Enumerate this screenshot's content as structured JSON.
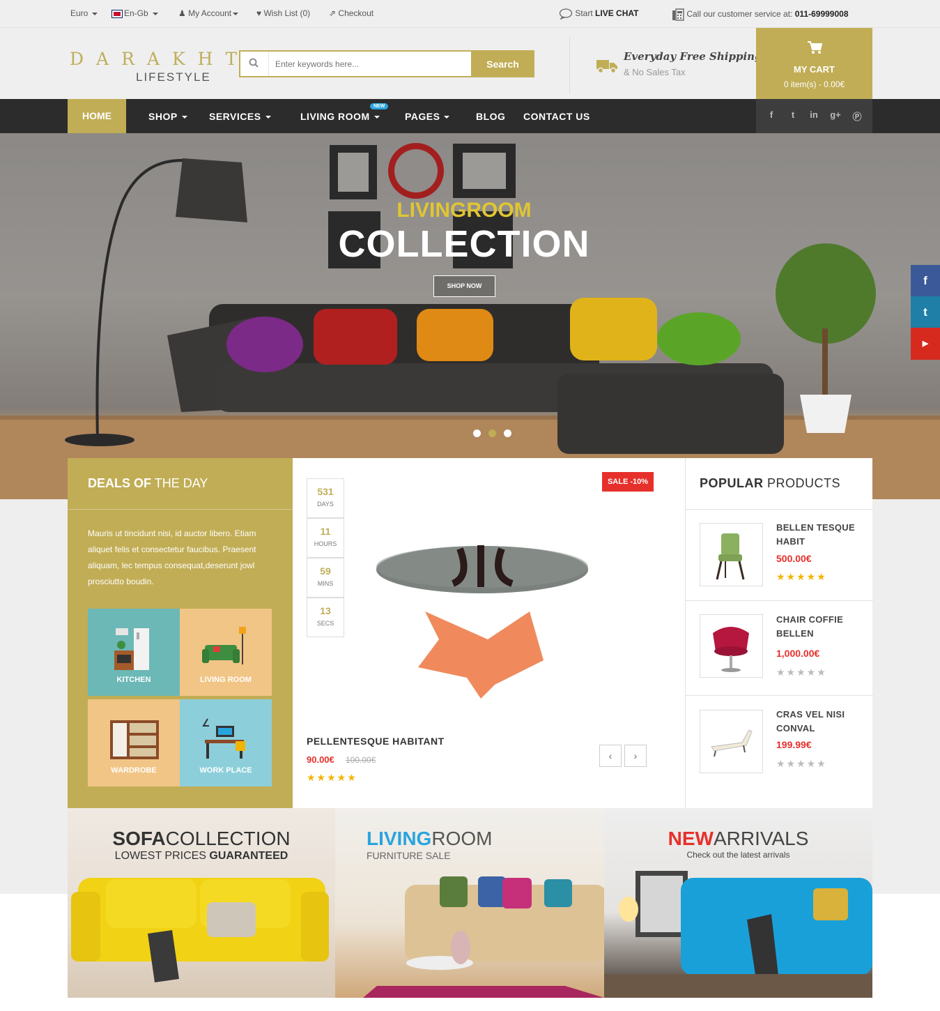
{
  "topbar": {
    "currency": "Euro",
    "language": "En-Gb",
    "account": "My Account",
    "wishlist": "Wish List (0)",
    "checkout": "Checkout",
    "chat_prefix": "Start",
    "chat_bold": "LIVE CHAT",
    "service_prefix": "Call our customer service at:",
    "service_phone": "011-69999008"
  },
  "header": {
    "logo_top": "DARAKHT",
    "logo_sub": "LIFESTYLE",
    "search_placeholder": "Enter keywords here...",
    "search_button": "Search",
    "shipping_title": "Everyday Free Shipping",
    "shipping_sub": "& No Sales Tax",
    "cart_title": "MY CART",
    "cart_summary": "0 item(s) - 0.00€"
  },
  "nav": {
    "items": [
      "HOME",
      "SHOP",
      "SERVICES",
      "LIVING ROOM",
      "PAGES",
      "BLOG",
      "CONTACT US"
    ],
    "new_badge": "NEW"
  },
  "hero": {
    "kicker": "LIVINGROOM",
    "title": "COLLECTION",
    "button": "SHOP NOW",
    "slides": 3,
    "active_slide": 2
  },
  "deals": {
    "title_bold": "DEALS OF",
    "title_light": "THE DAY",
    "description": "Mauris ut tincidunt nisi, id auctor libero. Etiam aliquet felis et consectetur faucibus. Praesent aliquam, lec tempus consequat,deserunt jowl prosciutto boudin.",
    "tiles": [
      {
        "label": "KITCHEN",
        "color": "#6cb8b7"
      },
      {
        "label": "LIVING ROOM",
        "color": "#f1c586"
      },
      {
        "label": "WARDROBE",
        "color": "#f1c586"
      },
      {
        "label": "WORK PLACE",
        "color": "#8ccfda"
      }
    ]
  },
  "deal_product": {
    "countdown": [
      {
        "value": "531",
        "unit": "DAYS"
      },
      {
        "value": "11",
        "unit": "HOURS"
      },
      {
        "value": "59",
        "unit": "MINS"
      },
      {
        "value": "13",
        "unit": "SECS"
      }
    ],
    "sale_badge": "SALE -10%",
    "name": "PELLENTESQUE HABITANT",
    "price": "90.00€",
    "old_price": "100.00€",
    "rating": 5
  },
  "popular": {
    "title_bold": "POPULAR",
    "title_light": "PRODUCTS",
    "items": [
      {
        "name": "BELLEN TESQUE HABIT",
        "price": "500.00€",
        "rating": 5
      },
      {
        "name": "CHAIR COFFIE BELLEN",
        "price": "1,000.00€",
        "rating": 0
      },
      {
        "name": "CRAS VEL NISI CONVAL",
        "price": "199.99€",
        "rating": 0
      }
    ]
  },
  "banners": [
    {
      "title_bold": "SOFA",
      "title_light": "COLLECTION",
      "sub_light": "LOWEST PRICES",
      "sub_bold": "GUARANTEED"
    },
    {
      "title_bold": "LIVING",
      "title_light": "ROOM",
      "sub_light": "FURNITURE SALE",
      "sub_bold": ""
    },
    {
      "title_bold": "NEW",
      "title_light": "ARRIVALS",
      "sub_light": "Check out the latest arrivals",
      "sub_bold": ""
    }
  ],
  "colors": {
    "accent": "#c1ad55",
    "dark": "#2c2c2c",
    "sale": "#e6302b",
    "facebook": "#3b5998",
    "twitter": "#1f7fa6",
    "youtube": "#d62a1e"
  }
}
